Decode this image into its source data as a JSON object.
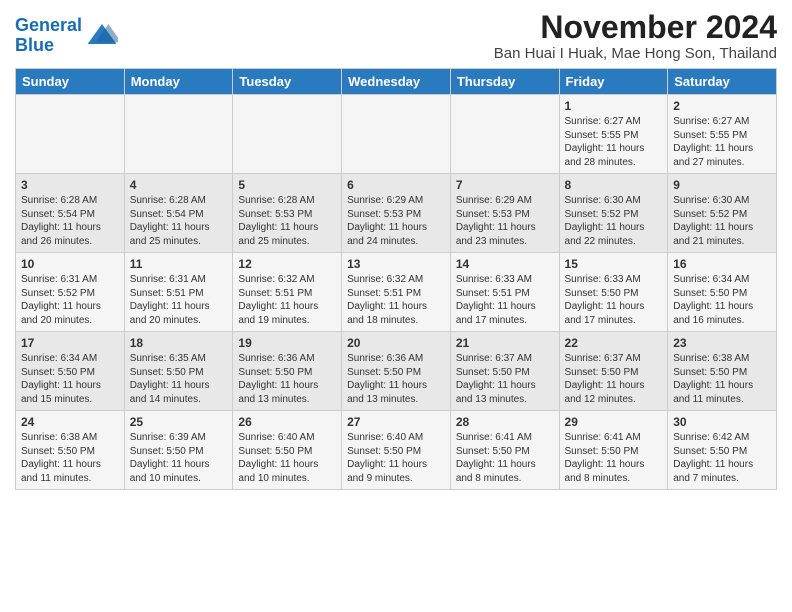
{
  "header": {
    "logo_line1": "General",
    "logo_line2": "Blue",
    "title": "November 2024",
    "subtitle": "Ban Huai I Huak, Mae Hong Son, Thailand"
  },
  "days_of_week": [
    "Sunday",
    "Monday",
    "Tuesday",
    "Wednesday",
    "Thursday",
    "Friday",
    "Saturday"
  ],
  "weeks": [
    [
      {
        "day": "",
        "info": ""
      },
      {
        "day": "",
        "info": ""
      },
      {
        "day": "",
        "info": ""
      },
      {
        "day": "",
        "info": ""
      },
      {
        "day": "",
        "info": ""
      },
      {
        "day": "1",
        "info": "Sunrise: 6:27 AM\nSunset: 5:55 PM\nDaylight: 11 hours\nand 28 minutes."
      },
      {
        "day": "2",
        "info": "Sunrise: 6:27 AM\nSunset: 5:55 PM\nDaylight: 11 hours\nand 27 minutes."
      }
    ],
    [
      {
        "day": "3",
        "info": "Sunrise: 6:28 AM\nSunset: 5:54 PM\nDaylight: 11 hours\nand 26 minutes."
      },
      {
        "day": "4",
        "info": "Sunrise: 6:28 AM\nSunset: 5:54 PM\nDaylight: 11 hours\nand 25 minutes."
      },
      {
        "day": "5",
        "info": "Sunrise: 6:28 AM\nSunset: 5:53 PM\nDaylight: 11 hours\nand 25 minutes."
      },
      {
        "day": "6",
        "info": "Sunrise: 6:29 AM\nSunset: 5:53 PM\nDaylight: 11 hours\nand 24 minutes."
      },
      {
        "day": "7",
        "info": "Sunrise: 6:29 AM\nSunset: 5:53 PM\nDaylight: 11 hours\nand 23 minutes."
      },
      {
        "day": "8",
        "info": "Sunrise: 6:30 AM\nSunset: 5:52 PM\nDaylight: 11 hours\nand 22 minutes."
      },
      {
        "day": "9",
        "info": "Sunrise: 6:30 AM\nSunset: 5:52 PM\nDaylight: 11 hours\nand 21 minutes."
      }
    ],
    [
      {
        "day": "10",
        "info": "Sunrise: 6:31 AM\nSunset: 5:52 PM\nDaylight: 11 hours\nand 20 minutes."
      },
      {
        "day": "11",
        "info": "Sunrise: 6:31 AM\nSunset: 5:51 PM\nDaylight: 11 hours\nand 20 minutes."
      },
      {
        "day": "12",
        "info": "Sunrise: 6:32 AM\nSunset: 5:51 PM\nDaylight: 11 hours\nand 19 minutes."
      },
      {
        "day": "13",
        "info": "Sunrise: 6:32 AM\nSunset: 5:51 PM\nDaylight: 11 hours\nand 18 minutes."
      },
      {
        "day": "14",
        "info": "Sunrise: 6:33 AM\nSunset: 5:51 PM\nDaylight: 11 hours\nand 17 minutes."
      },
      {
        "day": "15",
        "info": "Sunrise: 6:33 AM\nSunset: 5:50 PM\nDaylight: 11 hours\nand 17 minutes."
      },
      {
        "day": "16",
        "info": "Sunrise: 6:34 AM\nSunset: 5:50 PM\nDaylight: 11 hours\nand 16 minutes."
      }
    ],
    [
      {
        "day": "17",
        "info": "Sunrise: 6:34 AM\nSunset: 5:50 PM\nDaylight: 11 hours\nand 15 minutes."
      },
      {
        "day": "18",
        "info": "Sunrise: 6:35 AM\nSunset: 5:50 PM\nDaylight: 11 hours\nand 14 minutes."
      },
      {
        "day": "19",
        "info": "Sunrise: 6:36 AM\nSunset: 5:50 PM\nDaylight: 11 hours\nand 13 minutes."
      },
      {
        "day": "20",
        "info": "Sunrise: 6:36 AM\nSunset: 5:50 PM\nDaylight: 11 hours\nand 13 minutes."
      },
      {
        "day": "21",
        "info": "Sunrise: 6:37 AM\nSunset: 5:50 PM\nDaylight: 11 hours\nand 13 minutes."
      },
      {
        "day": "22",
        "info": "Sunrise: 6:37 AM\nSunset: 5:50 PM\nDaylight: 11 hours\nand 12 minutes."
      },
      {
        "day": "23",
        "info": "Sunrise: 6:38 AM\nSunset: 5:50 PM\nDaylight: 11 hours\nand 11 minutes."
      }
    ],
    [
      {
        "day": "24",
        "info": "Sunrise: 6:38 AM\nSunset: 5:50 PM\nDaylight: 11 hours\nand 11 minutes."
      },
      {
        "day": "25",
        "info": "Sunrise: 6:39 AM\nSunset: 5:50 PM\nDaylight: 11 hours\nand 10 minutes."
      },
      {
        "day": "26",
        "info": "Sunrise: 6:40 AM\nSunset: 5:50 PM\nDaylight: 11 hours\nand 10 minutes."
      },
      {
        "day": "27",
        "info": "Sunrise: 6:40 AM\nSunset: 5:50 PM\nDaylight: 11 hours\nand 9 minutes."
      },
      {
        "day": "28",
        "info": "Sunrise: 6:41 AM\nSunset: 5:50 PM\nDaylight: 11 hours\nand 8 minutes."
      },
      {
        "day": "29",
        "info": "Sunrise: 6:41 AM\nSunset: 5:50 PM\nDaylight: 11 hours\nand 8 minutes."
      },
      {
        "day": "30",
        "info": "Sunrise: 6:42 AM\nSunset: 5:50 PM\nDaylight: 11 hours\nand 7 minutes."
      }
    ]
  ]
}
